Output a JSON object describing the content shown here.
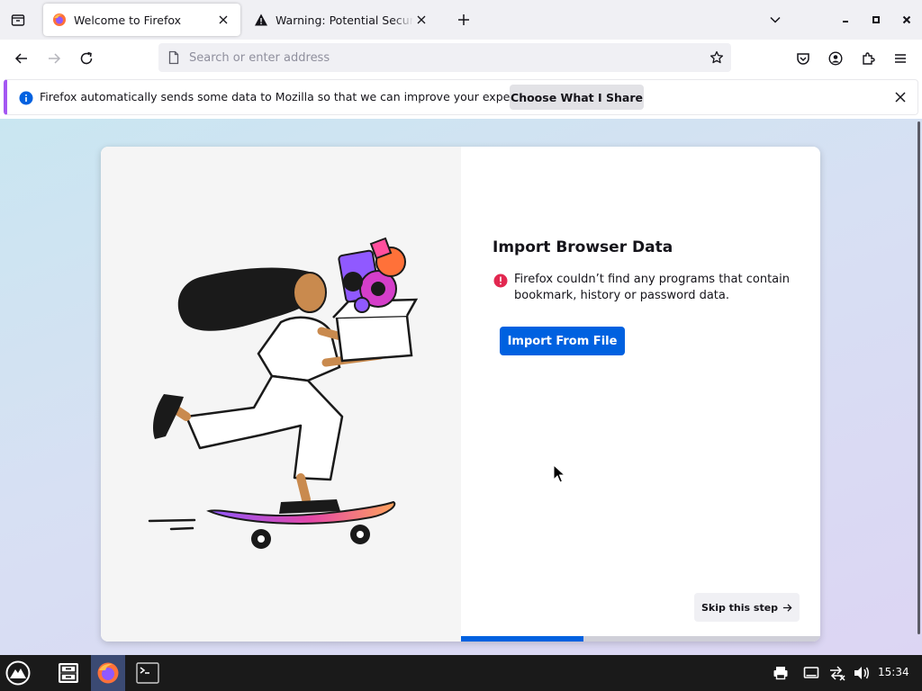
{
  "tabs": [
    {
      "title": "Welcome to Firefox",
      "active": true,
      "icon": "firefox-icon"
    },
    {
      "title": "Warning: Potential Security Risk Ahead",
      "active": false,
      "icon": "warning-icon"
    }
  ],
  "urlbar": {
    "placeholder": "Search or enter address",
    "value": ""
  },
  "notification": {
    "message": "Firefox automatically sends some data to Mozilla so that we can improve your experience.",
    "button_label": "Choose What I Share"
  },
  "onboarding": {
    "title": "Import Browser Data",
    "error_message": "Firefox couldn’t find any programs that contain bookmark, history or password data.",
    "import_button": "Import From File",
    "skip_button": "Skip this step",
    "progress": 0.34
  },
  "taskbar": {
    "clock": "15:34"
  },
  "colors": {
    "accent": "#0061e0",
    "notification_border": "#a457f2",
    "error": "#e22850",
    "taskbar": "#1a1a1a"
  }
}
